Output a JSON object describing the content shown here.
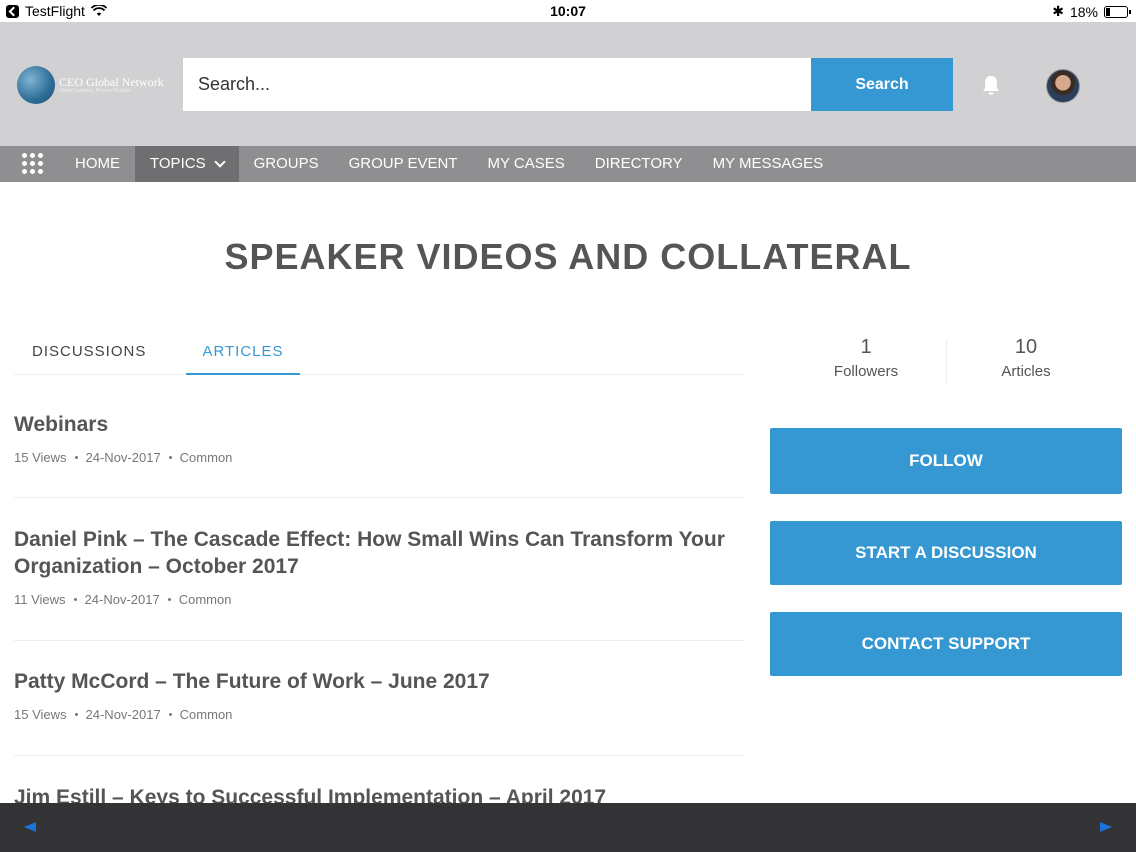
{
  "status_bar": {
    "app": "TestFlight",
    "time": "10:07",
    "battery": "18%"
  },
  "header": {
    "logo_title": "CEO Global Network",
    "logo_subtitle": "Global Leaders. Proven Results.",
    "search_placeholder": "Search...",
    "search_button": "Search"
  },
  "nav": {
    "items": [
      {
        "label": "HOME"
      },
      {
        "label": "TOPICS"
      },
      {
        "label": "GROUPS"
      },
      {
        "label": "GROUP EVENT"
      },
      {
        "label": "MY CASES"
      },
      {
        "label": "DIRECTORY"
      },
      {
        "label": "MY MESSAGES"
      }
    ],
    "active": "TOPICS"
  },
  "page_title": "SPEAKER VIDEOS AND COLLATERAL",
  "tabs": {
    "discussions": "DISCUSSIONS",
    "articles": "ARTICLES",
    "active": "ARTICLES"
  },
  "articles": [
    {
      "title": "Webinars",
      "views": "15 Views",
      "date": "24-Nov-2017",
      "category": "Common"
    },
    {
      "title": "Daniel Pink – The Cascade Effect: How Small Wins Can Transform Your Organization – October 2017",
      "views": "11 Views",
      "date": "24-Nov-2017",
      "category": "Common"
    },
    {
      "title": "Patty McCord – The Future of Work – June 2017",
      "views": "15 Views",
      "date": "24-Nov-2017",
      "category": "Common"
    },
    {
      "title": "Jim Estill – Keys to Successful Implementation – April 2017"
    }
  ],
  "stats": {
    "followers_count": "1",
    "followers_label": "Followers",
    "articles_count": "10",
    "articles_label": "Articles"
  },
  "actions": {
    "follow": "FOLLOW",
    "start_discussion": "START A DISCUSSION",
    "contact_support": "CONTACT SUPPORT"
  },
  "colors": {
    "accent": "#3598d2",
    "header_bg": "#d1d1d3",
    "nav_bg": "#8f8f91",
    "nav_active": "#6f6f71"
  }
}
